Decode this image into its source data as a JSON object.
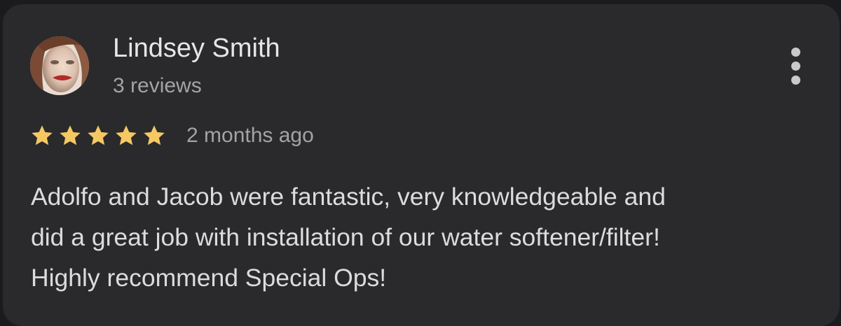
{
  "review": {
    "author_name": "Lindsey Smith",
    "author_reviews": "3 reviews",
    "rating": 5,
    "rating_max": 5,
    "time_ago": "2 months ago",
    "text_lines": [
      "Adolfo and Jacob were fantastic, very knowledgeable and",
      "did a great job with installation of our water softener/filter!",
      "Highly recommend Special Ops!"
    ]
  },
  "icons": {
    "avatar": "profile-photo",
    "star": "star-icon",
    "menu": "more-vert-icon"
  },
  "colors": {
    "background": "#1b1b1d",
    "card": "#2a2a2c",
    "star": "#f6c863",
    "primary_text": "#e6e6e8",
    "secondary_text": "#a3a3a7"
  }
}
